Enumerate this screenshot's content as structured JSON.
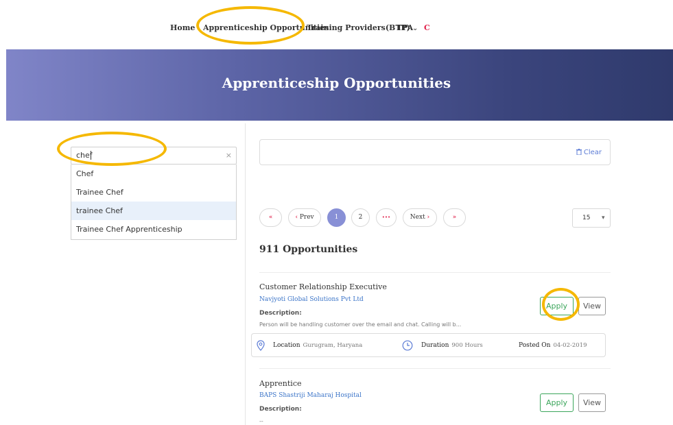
{
  "nav": {
    "home": "Home",
    "apprenticeship": "Apprenticeship Opportunities",
    "training_providers": "Training Providers(BTP)",
    "training_chevron": "⌄",
    "tpa": "TPA",
    "cut_item": "C"
  },
  "banner": {
    "title": "Apprenticeship Opportunities"
  },
  "search": {
    "value": "chef",
    "clear_icon": "×",
    "suggestions": [
      "Chef",
      "Trainee Chef",
      "trainee Chef",
      "Trainee Chef Apprenticeship"
    ],
    "highlighted_index": 2
  },
  "filter": {
    "clear_label": "Clear",
    "clear_icon": "trash-icon"
  },
  "pagination": {
    "first": "«",
    "prev_arrow": "‹",
    "prev": "Prev",
    "pages": [
      "1",
      "2"
    ],
    "current": "1",
    "more": "•••",
    "next": "Next",
    "next_arrow": "›",
    "last": "»",
    "per_page": "15",
    "per_page_arrow": "▾"
  },
  "results": {
    "count": "911 Opportunities"
  },
  "jobs": [
    {
      "title": "Customer Relationship Executive",
      "company": "Navjyoti Global Solutions Pvt Ltd",
      "desc_label": "Description:",
      "desc": "Person will be handling customer over the email and chat. Calling will b...",
      "location_label": "Location",
      "location": "Gurugram, Haryana",
      "duration_label": "Duration",
      "duration": "900 Hours",
      "posted_label": "Posted On",
      "posted": "04-02-2019",
      "apply": "Apply",
      "view": "View"
    },
    {
      "title": "Apprentice",
      "company": "BAPS Shastriji Maharaj Hospital",
      "desc_label": "Description:",
      "desc": "--",
      "apply": "Apply",
      "view": "View"
    }
  ],
  "colors": {
    "accent": "#8890d6",
    "apply_green": "#3aa55a",
    "link_blue": "#3b74c8",
    "highlight": "#f5b800",
    "pager_red": "#e0204a"
  }
}
